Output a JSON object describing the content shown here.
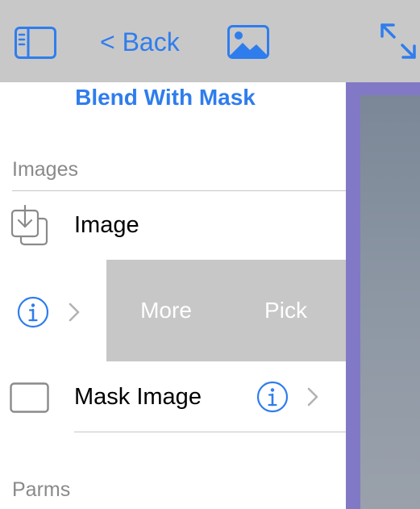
{
  "toolbar": {
    "back_label": "< Back",
    "icons": {
      "sidebar": "sidebar-toggle-icon",
      "photo": "photo-icon",
      "expand": "expand-icon"
    },
    "accent_color": "#2f7ded"
  },
  "panel": {
    "title": "Blend With Mask",
    "sections": [
      {
        "header": "Images",
        "rows": [
          {
            "label": "Image",
            "icon": "image-input-icon",
            "info_icon": "info-icon",
            "disclosure_icon": "chevron-right-icon",
            "swipe_actions": [
              "More",
              "Pick"
            ]
          },
          {
            "label": "Mask Image",
            "icon": "empty-image-icon",
            "info_icon": "info-icon",
            "disclosure_icon": "chevron-right-icon"
          }
        ]
      },
      {
        "header": "Parms",
        "rows": []
      }
    ]
  },
  "colors": {
    "toolbar_bg": "#c8c8c8",
    "preview_border": "#8279c6",
    "swipe_bg": "#c7c7c7"
  }
}
